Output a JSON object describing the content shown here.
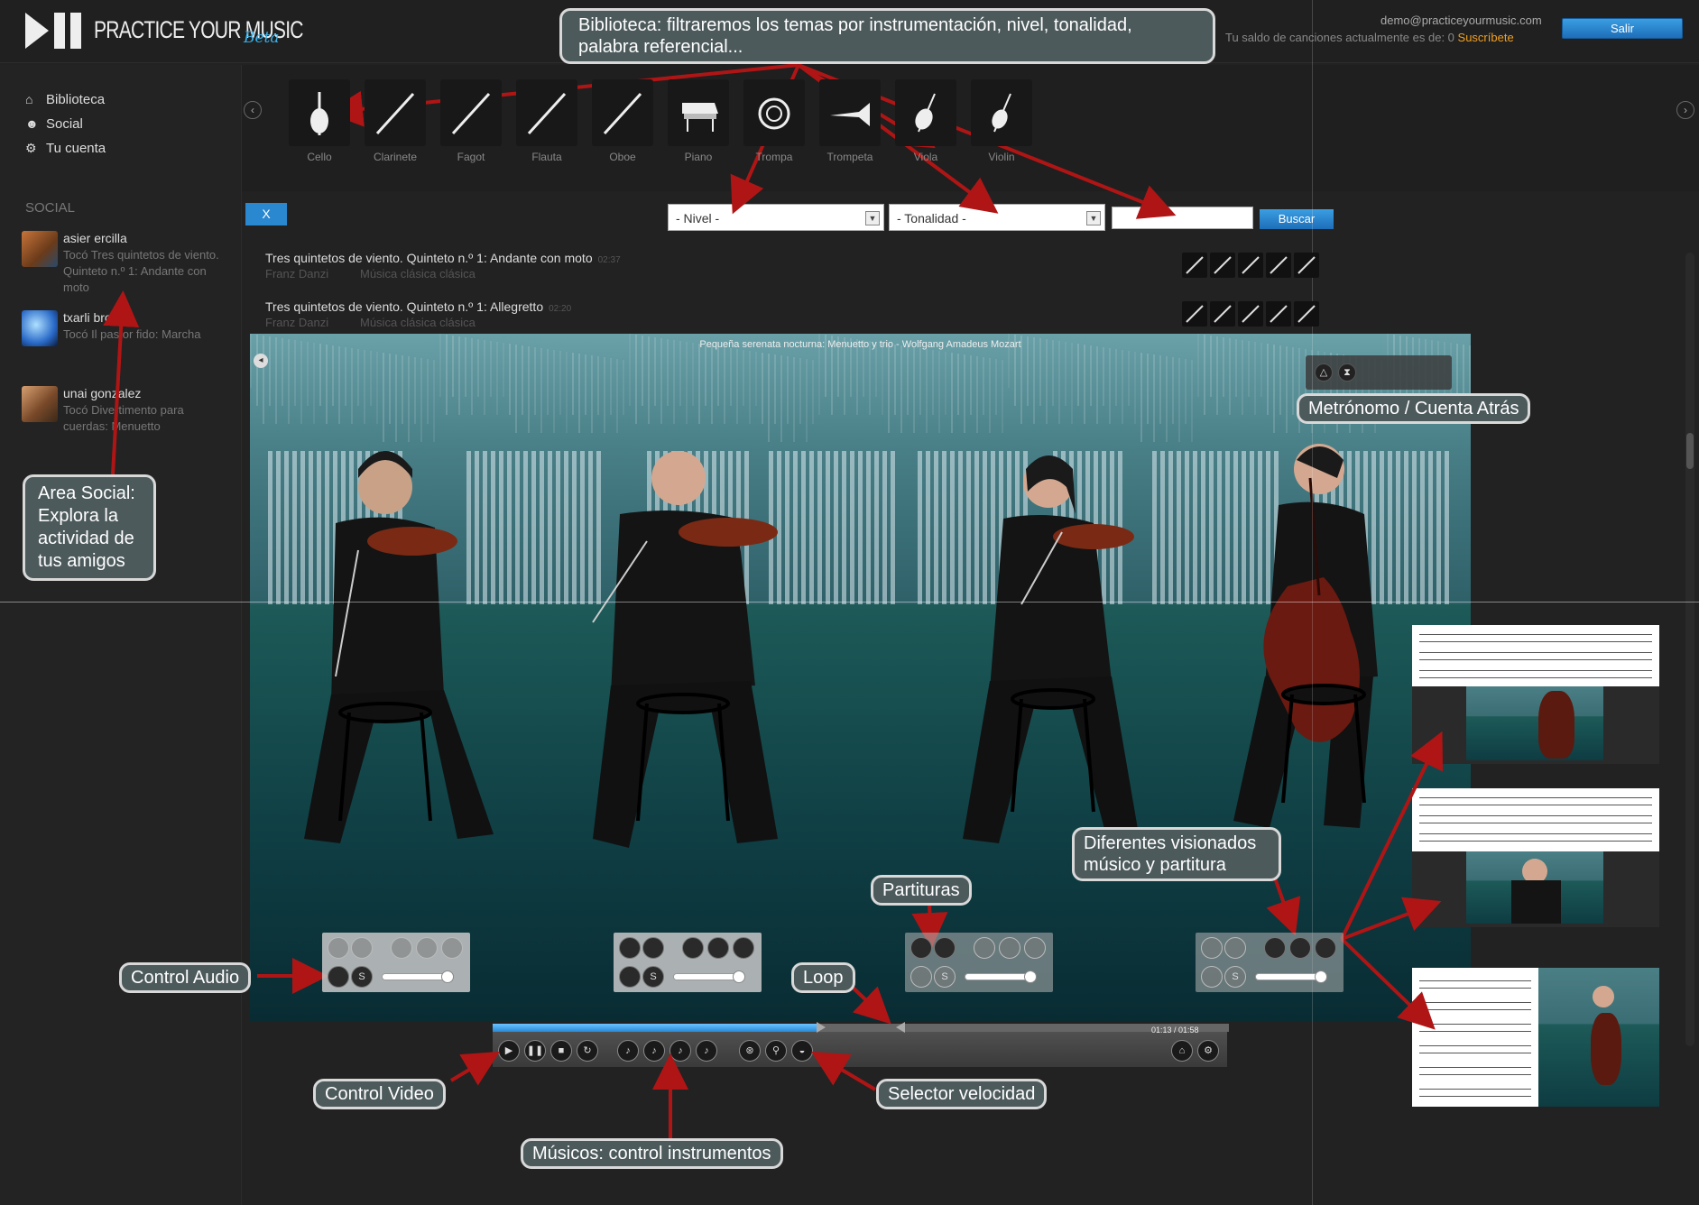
{
  "header": {
    "logo_text": "PRACTICE YOUR MUSIC",
    "logo_beta": "Beta",
    "user_email": "demo@practiceyourmusic.com",
    "balance_text": "Tu saldo de canciones actualmente es de: 0",
    "subscribe_label": "Suscríbete",
    "logout_label": "Salir"
  },
  "sidebar": {
    "nav": [
      {
        "label": "Biblioteca",
        "icon": "home-icon"
      },
      {
        "label": "Social",
        "icon": "user-icon"
      },
      {
        "label": "Tu cuenta",
        "icon": "gear-icon"
      }
    ],
    "social_heading": "SOCIAL",
    "friends": [
      {
        "name": "asier ercilla",
        "activity": "Tocó Tres quintetos de viento. Quinteto n.º 1: Andante con moto"
      },
      {
        "name": "txarli brown",
        "activity": "Tocó Il pastor fido: Marcha"
      },
      {
        "name": "unai gonzalez",
        "activity": "Tocó Divertimento para cuerdas: Menuetto"
      }
    ]
  },
  "instruments": [
    "Cello",
    "Clarinete",
    "Fagot",
    "Flauta",
    "Oboe",
    "Piano",
    "Trompa",
    "Trompeta",
    "Viola",
    "Violin"
  ],
  "filters": {
    "clear_label": "X",
    "level_placeholder": "- Nivel -",
    "key_placeholder": "- Tonalidad -",
    "search_value": "",
    "search_label": "Buscar"
  },
  "results": [
    {
      "title": "Tres quintetos de viento. Quinteto n.º 1: Andante con moto",
      "duration": "02:37",
      "composer": "Franz Danzi",
      "genre": "Música clásica clásica"
    },
    {
      "title": "Tres quintetos de viento. Quinteto n.º 1: Allegretto",
      "duration": "02:20",
      "composer": "Franz Danzi",
      "genre": "Música clásica clásica"
    }
  ],
  "player": {
    "video_title": "Pequeña serenata nocturna: Menuetto y trio - Wolfgang Amadeus Mozart",
    "time": "01:13 / 01:58",
    "progress": 0.44,
    "loop_start": 0.44,
    "loop_end": 0.56,
    "musician_volumes": [
      0.9,
      0.9,
      0.9,
      0.9
    ]
  },
  "callouts": {
    "biblioteca": "Biblioteca: filtraremos los temas por instrumentación, nivel, tonalidad, palabra referencial...",
    "social": "Area Social: Explora la actividad de tus amigos",
    "metronome": "Metrónomo / Cuenta Atrás",
    "views": "Diferentes visionados músico y partitura",
    "scores": "Partituras",
    "audio": "Control Audio",
    "loop": "Loop",
    "video": "Control Video",
    "speed": "Selector velocidad",
    "musicians": "Músicos: control instrumentos"
  },
  "colors": {
    "accent": "#2a88d0",
    "subscribe": "#f0a020",
    "arrow": "#b01515",
    "callout_bg": "#4d5a5c"
  }
}
